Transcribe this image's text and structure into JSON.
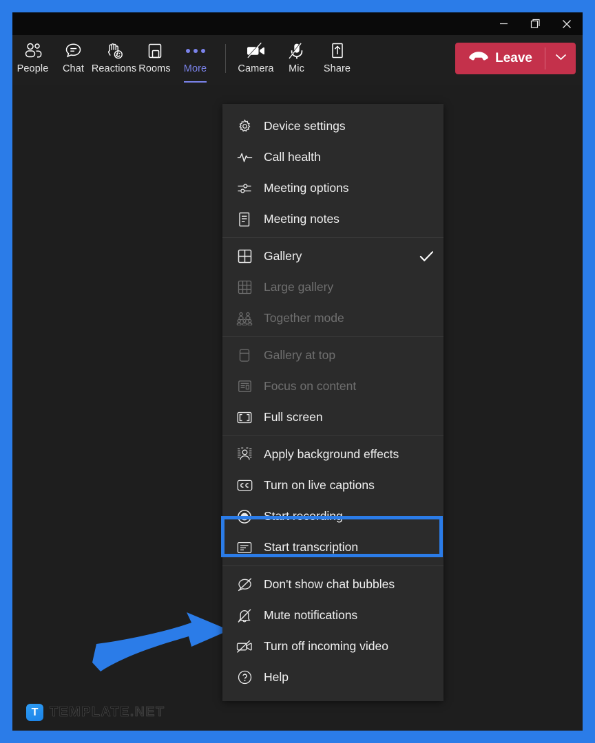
{
  "colors": {
    "frame_blue": "#2b7ce8",
    "highlight_blue": "#2b7ce8",
    "leave_red": "#c4314b",
    "accent_purple": "#7b83eb",
    "menu_bg": "#2b2b2b",
    "toolbar_bg": "#1f1f1f",
    "stage_bg": "#1e1e1e",
    "titlebar_bg": "#0a0a0a"
  },
  "titlebar": {
    "minimize": "Minimize",
    "restore": "Restore",
    "close": "Close"
  },
  "toolbar": {
    "items": [
      {
        "label": "People",
        "icon": "people-icon",
        "active": false
      },
      {
        "label": "Chat",
        "icon": "chat-icon",
        "active": false
      },
      {
        "label": "Reactions",
        "icon": "reactions-icon",
        "active": false
      },
      {
        "label": "Rooms",
        "icon": "rooms-icon",
        "active": false
      },
      {
        "label": "More",
        "icon": "more-dots-icon",
        "active": true
      },
      {
        "label": "Camera",
        "icon": "camera-off-icon",
        "active": false
      },
      {
        "label": "Mic",
        "icon": "mic-off-icon",
        "active": false
      },
      {
        "label": "Share",
        "icon": "share-icon",
        "active": false
      }
    ],
    "leave_label": "Leave",
    "leave_icon": "hangup-icon",
    "leave_chevron_icon": "chevron-down-icon"
  },
  "more_menu": {
    "groups": [
      {
        "items": [
          {
            "label": "Device settings",
            "icon": "gear-icon",
            "disabled": false,
            "checked": false
          },
          {
            "label": "Call health",
            "icon": "pulse-icon",
            "disabled": false,
            "checked": false
          },
          {
            "label": "Meeting options",
            "icon": "sliders-icon",
            "disabled": false,
            "checked": false
          },
          {
            "label": "Meeting notes",
            "icon": "notes-icon",
            "disabled": false,
            "checked": false
          }
        ]
      },
      {
        "items": [
          {
            "label": "Gallery",
            "icon": "gallery-icon",
            "disabled": false,
            "checked": true
          },
          {
            "label": "Large gallery",
            "icon": "large-gallery-icon",
            "disabled": true,
            "checked": false
          },
          {
            "label": "Together mode",
            "icon": "together-mode-icon",
            "disabled": true,
            "checked": false
          }
        ]
      },
      {
        "items": [
          {
            "label": "Gallery at top",
            "icon": "gallery-top-icon",
            "disabled": true,
            "checked": false
          },
          {
            "label": "Focus on content",
            "icon": "focus-icon",
            "disabled": true,
            "checked": false
          },
          {
            "label": "Full screen",
            "icon": "fullscreen-icon",
            "disabled": false,
            "checked": false
          }
        ]
      },
      {
        "items": [
          {
            "label": "Apply background effects",
            "icon": "background-effects-icon",
            "disabled": false,
            "checked": false
          },
          {
            "label": "Turn on live captions",
            "icon": "closed-caption-icon",
            "disabled": false,
            "checked": false
          },
          {
            "label": "Start recording",
            "icon": "record-icon",
            "disabled": false,
            "checked": false,
            "highlighted": true
          },
          {
            "label": "Start transcription",
            "icon": "transcription-icon",
            "disabled": false,
            "checked": false
          }
        ]
      },
      {
        "items": [
          {
            "label": "Don't show chat bubbles",
            "icon": "chat-bubble-off-icon",
            "disabled": false,
            "checked": false
          },
          {
            "label": "Mute notifications",
            "icon": "bell-off-icon",
            "disabled": false,
            "checked": false
          },
          {
            "label": "Turn off incoming video",
            "icon": "video-off-icon",
            "disabled": false,
            "checked": false
          },
          {
            "label": "Help",
            "icon": "help-icon",
            "disabled": false,
            "checked": false
          }
        ]
      }
    ]
  },
  "annotation": {
    "arrow_icon": "pointer-arrow-icon",
    "target": "Start recording"
  },
  "watermark": {
    "logo_letter": "T",
    "name": "TEMPLATE",
    "tld": ".NET"
  }
}
